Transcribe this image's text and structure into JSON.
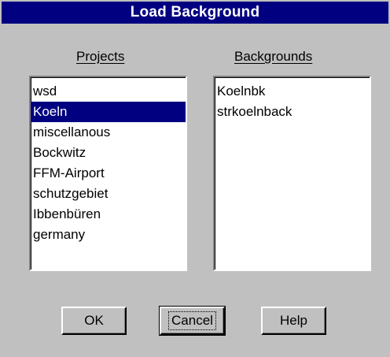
{
  "dialog": {
    "title": "Load Background"
  },
  "projects": {
    "label": "Projects",
    "items": [
      "wsd",
      "Koeln",
      "miscellanous",
      "Bockwitz",
      "FFM-Airport",
      "schutzgebiet",
      "Ibbenbüren",
      "germany"
    ],
    "selected_index": 1
  },
  "backgrounds": {
    "label": "Backgrounds",
    "items": [
      "Koelnbk",
      "strkoelnback"
    ]
  },
  "buttons": {
    "ok": "OK",
    "cancel": "Cancel",
    "help": "Help"
  },
  "colors": {
    "titlebar": "#000080",
    "selection": "#000080",
    "face": "#c0c0c0"
  }
}
